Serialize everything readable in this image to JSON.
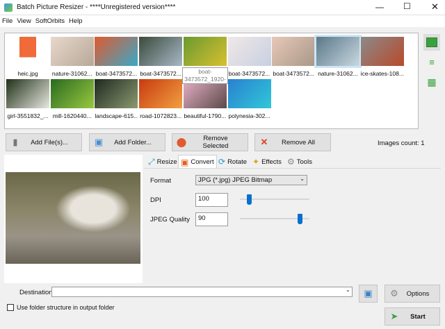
{
  "window": {
    "title": "Batch Picture Resizer - ****Unregistered version****",
    "controls": [
      "minimize",
      "maximize",
      "close"
    ]
  },
  "menu": [
    "File",
    "View",
    "SoftOrbits",
    "Help"
  ],
  "thumbnails": [
    {
      "label": "heic.jpg",
      "colors": [
        "#fff",
        "#f06a3a"
      ]
    },
    {
      "label": "nature-31062...",
      "colors": [
        "#e8d8cc",
        "#b8a898"
      ]
    },
    {
      "label": "boat-3473572...",
      "colors": [
        "#e05a30",
        "#3aa8c8"
      ]
    },
    {
      "label": "boat-3473572...",
      "colors": [
        "#3a4a3a",
        "#a8b8c8"
      ]
    },
    {
      "label": "boat-3473572...",
      "colors": [
        "#6a9a30",
        "#d8c030"
      ]
    },
    {
      "label": "boat-3473572...",
      "colors": [
        "#f0e8e8",
        "#c8d0e0"
      ]
    },
    {
      "label": "boat-3473572...",
      "colors": [
        "#e8c8b8",
        "#a89888"
      ]
    },
    {
      "label": "nature-31062...",
      "colors": [
        "#5a7888",
        "#c8d8e0"
      ],
      "selected": true
    },
    {
      "label": "ice-skates-108...",
      "colors": [
        "#8a8a8a",
        "#b84a2a"
      ]
    },
    {
      "label": "girl-3551832_...",
      "colors": [
        "#203018",
        "#e8e8e0"
      ]
    },
    {
      "label": "mill-1620440...",
      "colors": [
        "#2a6a20",
        "#98c840"
      ]
    },
    {
      "label": "landscape-615...",
      "colors": [
        "#202820",
        "#8a9a70"
      ]
    },
    {
      "label": "road-1072823...",
      "colors": [
        "#c83a10",
        "#f0a040"
      ]
    },
    {
      "label": "beautiful-1790...",
      "colors": [
        "#e8b0c8",
        "#5a4a48"
      ]
    },
    {
      "label": "polynesia-302...",
      "colors": [
        "#2a80d0",
        "#30c8d8"
      ]
    }
  ],
  "tooltip": "boat-\n3473572_1920-",
  "side_views": [
    "thumbnail-view",
    "list-view",
    "table-view"
  ],
  "buttons": {
    "add_files": "Add File(s)...",
    "add_folder": "Add Folder...",
    "remove_selected": "Remove Selected",
    "remove_all": "Remove All"
  },
  "images_count": "Images count: 1",
  "tabs": [
    "Resize",
    "Convert",
    "Rotate",
    "Effects",
    "Tools"
  ],
  "active_tab": "Convert",
  "convert": {
    "format_label": "Format",
    "format_value": "JPG (*.jpg) JPEG Bitmap",
    "dpi_label": "DPI",
    "dpi_value": "100",
    "dpi_slider_level": 0.13,
    "quality_label": "JPEG Quality",
    "quality_value": "90",
    "quality_slider_level": 0.86
  },
  "destination": {
    "label": "Destination",
    "value": ""
  },
  "folder_structure_label": "Use folder structure in output folder",
  "folder_structure_checked": false,
  "options_label": "Options",
  "start_label": "Start"
}
